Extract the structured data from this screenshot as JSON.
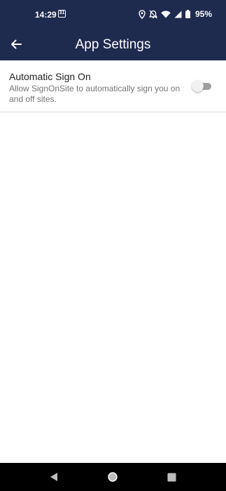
{
  "status_bar": {
    "time": "14:29",
    "calendar_day": "31",
    "battery": "95%",
    "icons": [
      "location-icon",
      "alarm-off-icon",
      "wifi-icon",
      "signal-icon",
      "battery-icon"
    ]
  },
  "app_bar": {
    "title": "App Settings",
    "back_icon": "arrow-left-icon"
  },
  "settings": [
    {
      "title": "Automatic Sign On",
      "description": "Allow SignOnSite to automatically sign you on and off sites.",
      "toggle_on": false
    }
  ],
  "nav_bar": {
    "buttons": [
      "back-triangle-icon",
      "home-circle-icon",
      "recents-square-icon"
    ]
  },
  "colors": {
    "header_bg": "#1f2a4f",
    "background": "#ffffff",
    "nav_bg": "#000000"
  }
}
